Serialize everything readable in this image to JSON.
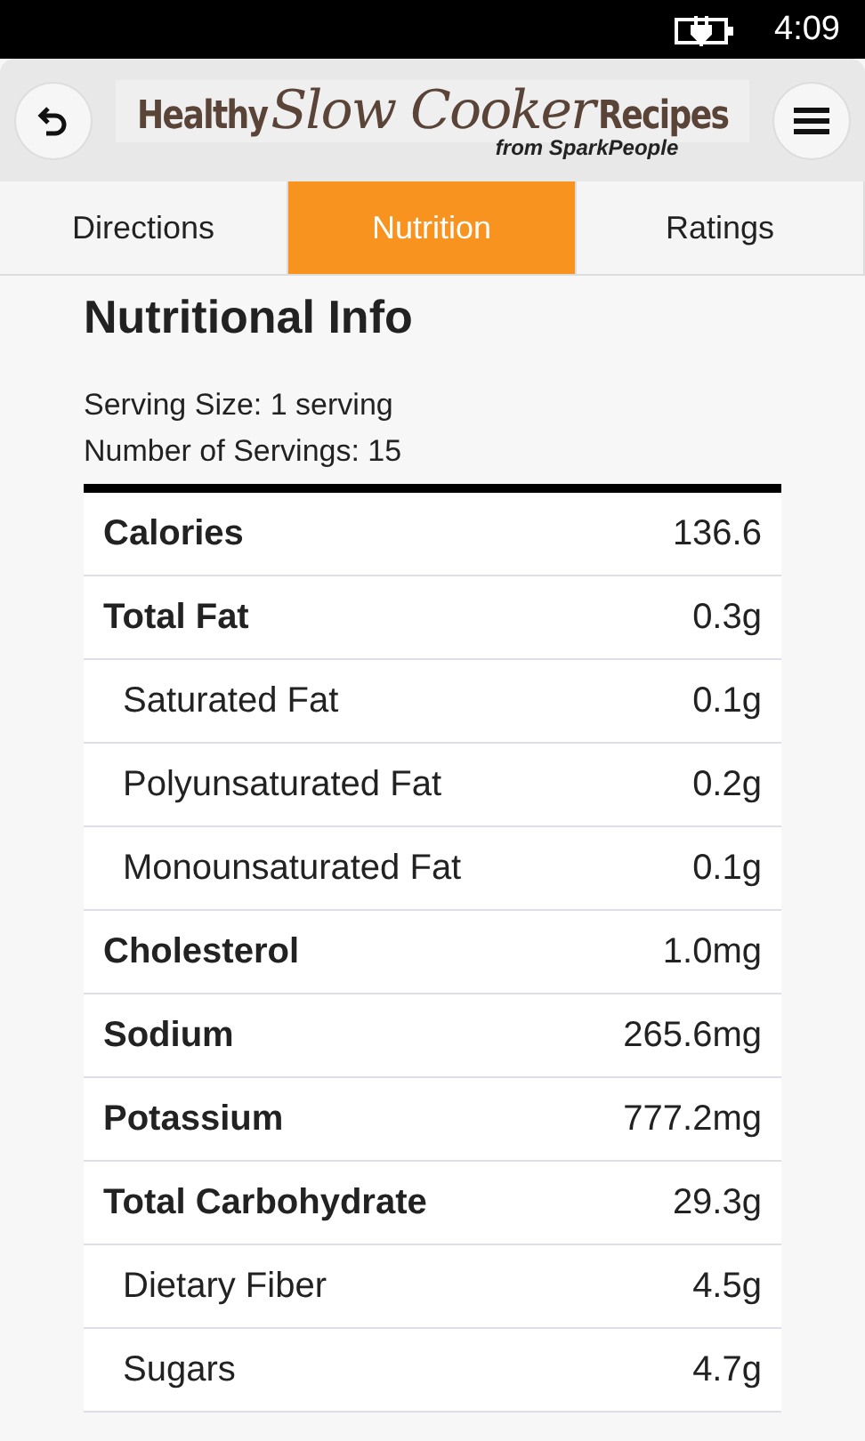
{
  "status_bar": {
    "time": "4:09"
  },
  "header": {
    "logo": {
      "lead": "Healthy",
      "script": "Slow Cooker",
      "trail": "Recipes",
      "tagline": "from SparkPeople"
    }
  },
  "tabs": [
    {
      "label": "Directions",
      "selected": false
    },
    {
      "label": "Nutrition",
      "selected": true
    },
    {
      "label": "Ratings",
      "selected": false
    }
  ],
  "nutrition": {
    "title": "Nutritional Info",
    "serving_size": "Serving Size: 1 serving",
    "servings": "Number of Servings: 15",
    "rows": [
      {
        "kind": "main",
        "name": "Calories",
        "value": "136.6"
      },
      {
        "kind": "main",
        "name": "Total Fat",
        "value": "0.3g"
      },
      {
        "kind": "sub",
        "name": "Saturated Fat",
        "value": "0.1g"
      },
      {
        "kind": "sub",
        "name": "Polyunsaturated Fat",
        "value": "0.2g"
      },
      {
        "kind": "sub",
        "name": "Monounsaturated Fat",
        "value": "0.1g"
      },
      {
        "kind": "main",
        "name": "Cholesterol",
        "value": "1.0mg"
      },
      {
        "kind": "main",
        "name": "Sodium",
        "value": "265.6mg"
      },
      {
        "kind": "main",
        "name": "Potassium",
        "value": "777.2mg"
      },
      {
        "kind": "main",
        "name": "Total Carbohydrate",
        "value": "29.3g"
      },
      {
        "kind": "sub",
        "name": "Dietary Fiber",
        "value": "4.5g"
      },
      {
        "kind": "sub",
        "name": "Sugars",
        "value": "4.7g"
      }
    ]
  }
}
